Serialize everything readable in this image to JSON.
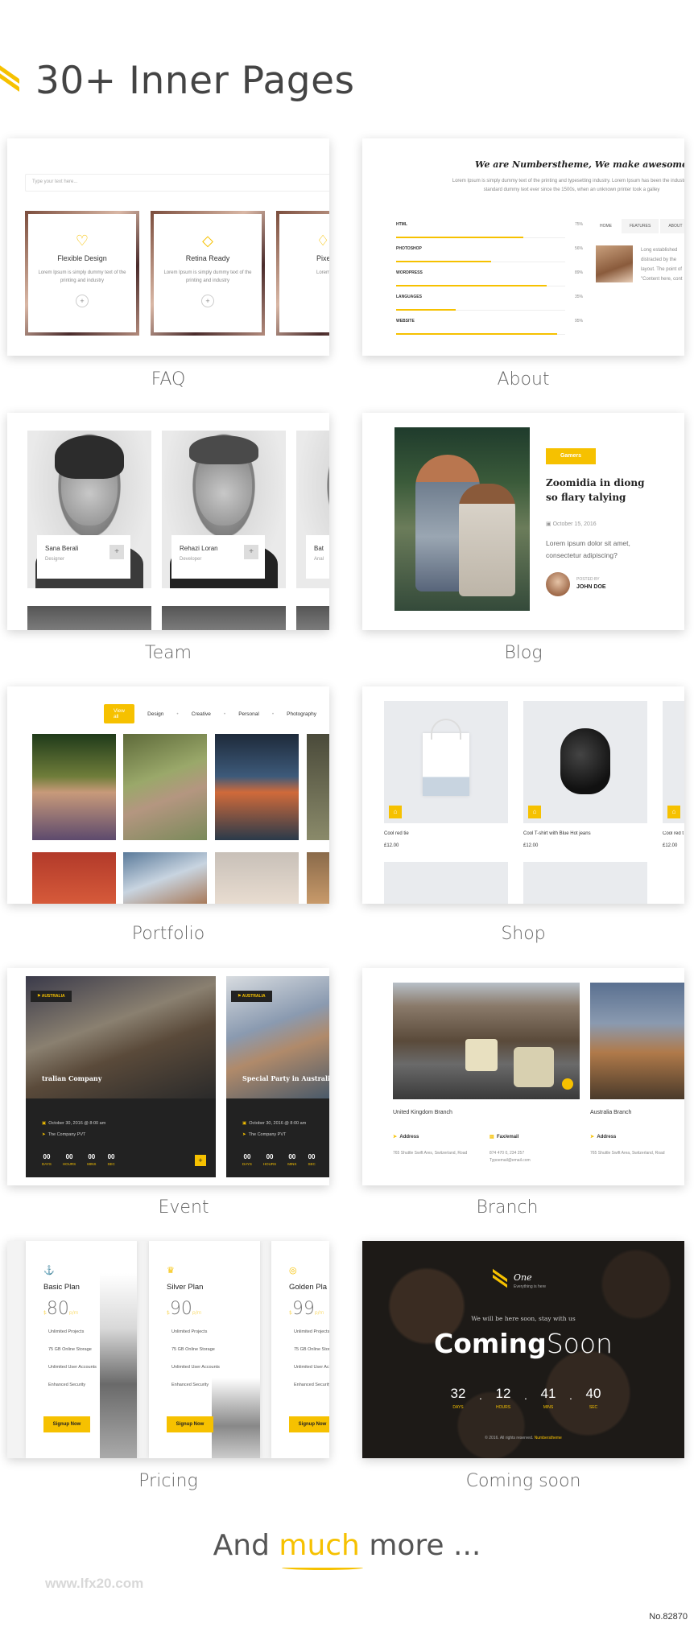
{
  "header": {
    "title": "30+ Inner Pages"
  },
  "cards": {
    "faq": {
      "label": "FAQ",
      "search_placeholder": "Type your text here...",
      "boxes": [
        {
          "title": "Flexible Design",
          "desc": "Lorem Ipsum is simply dummy text of the printing and industry"
        },
        {
          "title": "Retina Ready",
          "desc": "Lorem Ipsum is simply dummy text of the printing and industry"
        },
        {
          "title": "Pixel",
          "desc": "Lorem ipsum"
        }
      ]
    },
    "about": {
      "label": "About",
      "title": "We are Numberstheme, We make awesome template",
      "desc": "Lorem Ipsum is simply dummy text of the printing and typesetting industry. Lorem Ipsum has been the industry's standard dummy text ever since the 1500s, when an unknown printer took a galley",
      "skills": [
        {
          "name": "HTML",
          "pct": "75%",
          "v": 0.75
        },
        {
          "name": "PHOTOSHOP",
          "pct": "56%",
          "v": 0.56
        },
        {
          "name": "WORDPRESS",
          "pct": "89%",
          "v": 0.89
        },
        {
          "name": "LANGUAGES",
          "pct": "35%",
          "v": 0.35
        },
        {
          "name": "WEBSITE",
          "pct": "95%",
          "v": 0.95
        }
      ],
      "tabs": [
        "HOME",
        "FEATURES",
        "ABOUT"
      ],
      "side_text": "Long established distracted by the layout. The point of \"Content here, cont"
    },
    "team": {
      "label": "Team",
      "members": [
        {
          "name": "Sana Berali",
          "role": "Designer"
        },
        {
          "name": "Rehazi Loran",
          "role": "Developer"
        },
        {
          "name": "Bat",
          "role": "Anal"
        }
      ]
    },
    "blog": {
      "label": "Blog",
      "tag": "Gamers",
      "title": "Zoomidia in diong so flary talying",
      "date": "October 15, 2016",
      "excerpt": "Lorem ipsum dolor sit amet, consectetur adipiscing?",
      "posted_by": "POSTED BY",
      "author": "JOHN DOE"
    },
    "portfolio": {
      "label": "Portfolio",
      "filters": [
        "View all",
        "Design",
        "Creative",
        "Personal",
        "Photography"
      ]
    },
    "shop": {
      "label": "Shop",
      "items": [
        {
          "name": "Cool red tie",
          "price": "£12.00"
        },
        {
          "name": "Cool T-shirt with Blue Hot jeans",
          "price": "£12.00"
        },
        {
          "name": "Cool red t",
          "price": "£12.00"
        }
      ]
    },
    "event": {
      "label": "Event",
      "events": [
        {
          "tag": "AUSTRALIA",
          "title": "tralian Company",
          "date": "October 30, 2016 @ 8:00 am",
          "place": "The Company PVT"
        },
        {
          "tag": "AUSTRALIA",
          "title": "Special Party in Australia",
          "date": "October 30, 2016 @ 8:00 am",
          "place": "The Company PVT"
        }
      ],
      "countdown": [
        {
          "v": "00",
          "u": "DAYS"
        },
        {
          "v": "00",
          "u": "HOURS"
        },
        {
          "v": "00",
          "u": "MINS"
        },
        {
          "v": "00",
          "u": "SEC"
        }
      ]
    },
    "branch": {
      "label": "Branch",
      "branches": [
        {
          "name": "United Kingdom Branch"
        },
        {
          "name": "Australia Branch"
        }
      ],
      "address_h": "Address",
      "fax_h": "Fax/email",
      "address": "765 Shuttle Swift Ares, Switzerland, Road",
      "fax": "874 470 0, 234 257 Typoemail@email.com",
      "address2": "765 Shuttle Swift Area, Switzerland, Road"
    },
    "pricing": {
      "label": "Pricing",
      "plans": [
        {
          "name": "Basic Plan",
          "price": "80",
          "per": "p/m",
          "icon": "⚓"
        },
        {
          "name": "Silver Plan",
          "price": "90",
          "per": "p/m",
          "icon": "♛"
        },
        {
          "name": "Golden Pla",
          "price": "99",
          "per": "p/m",
          "icon": "◎"
        }
      ],
      "features": [
        "Unlimited Projects",
        "75 GB Online Storage",
        "Unlimited User Accounts",
        "Enhanced Security"
      ],
      "cta": "Signup Now"
    },
    "coming": {
      "label": "Coming soon",
      "logo": "One",
      "logo_sub": "Everything is here",
      "sub": "We will be here soon, stay with us",
      "t1": "Coming",
      "t2": "Soon",
      "countdown": [
        {
          "v": "32",
          "u": "DAYS"
        },
        {
          "v": "12",
          "u": "HOURS"
        },
        {
          "v": "41",
          "u": "MINS"
        },
        {
          "v": "40",
          "u": "SEC"
        }
      ],
      "footer": "© 2016. All rights reserved.",
      "footer_brand": "Numberstheme"
    }
  },
  "footer": {
    "pre": "And",
    "hl": "much",
    "post": "more ...",
    "watermark": "www.lfx20.com",
    "number": "No.82870"
  },
  "colors": {
    "accent": "#f6c100"
  }
}
